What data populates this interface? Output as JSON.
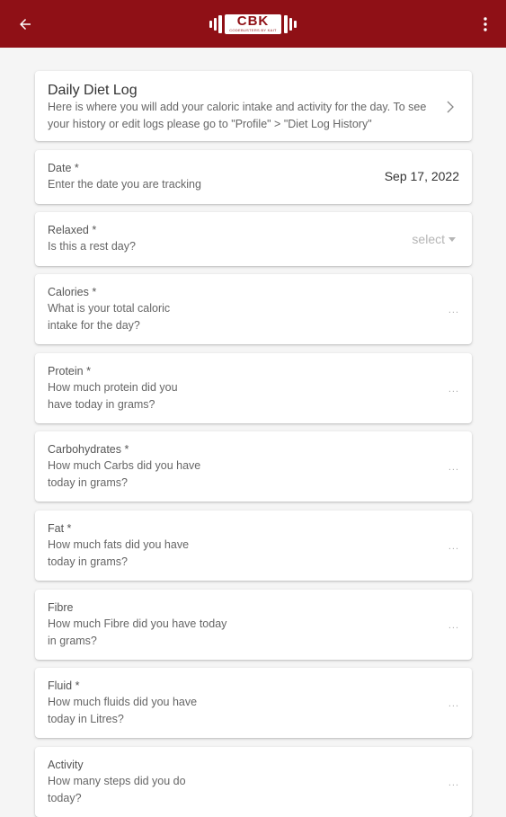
{
  "colors": {
    "appbar": "#8f1016",
    "card_bg": "#ffffff",
    "page_bg": "#f5f5f5"
  },
  "appbar": {
    "back_icon": "arrow-left-icon",
    "more_icon": "more-vert-icon",
    "logo": {
      "brand": "CBK",
      "tagline": "CODEBUSTERS BY KAIT"
    }
  },
  "intro": {
    "title": "Daily Diet Log",
    "description": "Here is where you will add your caloric intake and activity for the day. To see your history or edit logs please go to \"Profile\" > \"Diet Log History\"",
    "chevron_icon": "chevron-right-icon"
  },
  "date_field": {
    "label": "Date *",
    "hint": "Enter the date you are tracking",
    "value": "Sep 17, 2022"
  },
  "relaxed_field": {
    "label": "Relaxed *",
    "hint": "Is this a rest day?",
    "value": "select"
  },
  "calories_field": {
    "label": "Calories *",
    "hint": "What is your total caloric intake for the day?",
    "placeholder": "..."
  },
  "protein_field": {
    "label": "Protein *",
    "hint": "How much protein did you have today in grams?",
    "placeholder": "..."
  },
  "carbs_field": {
    "label": "Carbohydrates *",
    "hint": "How much Carbs did you have today in grams?",
    "placeholder": "..."
  },
  "fat_field": {
    "label": "Fat *",
    "hint": "How much fats did you have today in grams?",
    "placeholder": "..."
  },
  "fibre_field": {
    "label": "Fibre",
    "hint": "How much Fibre did you have today in grams?",
    "placeholder": "..."
  },
  "fluid_field": {
    "label": "Fluid *",
    "hint": "How much fluids did you have today in Litres?",
    "placeholder": "..."
  },
  "activity_field": {
    "label": "Activity",
    "hint": "How many steps did you do today?",
    "placeholder": "..."
  }
}
